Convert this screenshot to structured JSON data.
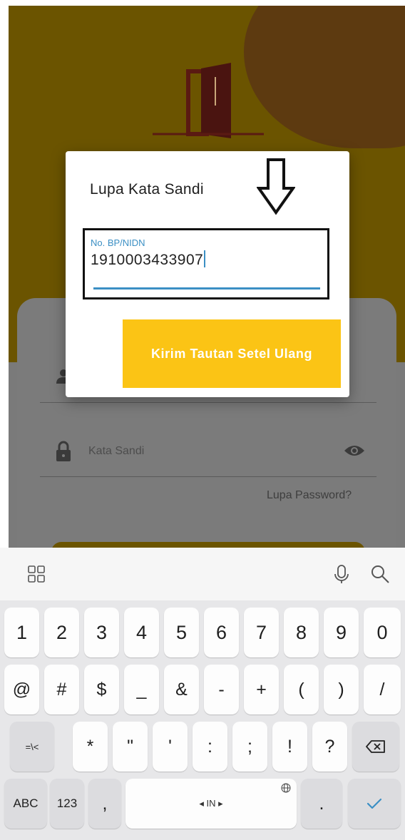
{
  "dialog": {
    "title": "Lupa Kata Sandi",
    "field_label": "No. BP/NIDN",
    "field_value": "1910003433907",
    "submit_label": "Kirim Tautan Setel Ulang"
  },
  "login": {
    "password_placeholder": "Kata Sandi",
    "forgot_link": "Lupa Password?"
  },
  "keyboard": {
    "toolbar_icons": [
      "apps-grid-icon",
      "microphone-icon",
      "search-icon"
    ],
    "row_numbers": [
      "1",
      "2",
      "3",
      "4",
      "5",
      "6",
      "7",
      "8",
      "9",
      "0"
    ],
    "row_symbols": [
      "@",
      "#",
      "$",
      "_",
      "&",
      "-",
      "+",
      "(",
      ")",
      "/"
    ],
    "row_punct_switch": "=\\<",
    "row_punct": [
      "*",
      "\"",
      "'",
      ":",
      ";",
      "!",
      "?"
    ],
    "abc_label": "ABC",
    "num_label": "123",
    "comma_label": ",",
    "space_label": "◂ IN ▸",
    "period_label": "."
  },
  "colors": {
    "accent_blue": "#3b8fc4",
    "button_yellow": "#fbc415",
    "background_gold": "#6b5400"
  }
}
